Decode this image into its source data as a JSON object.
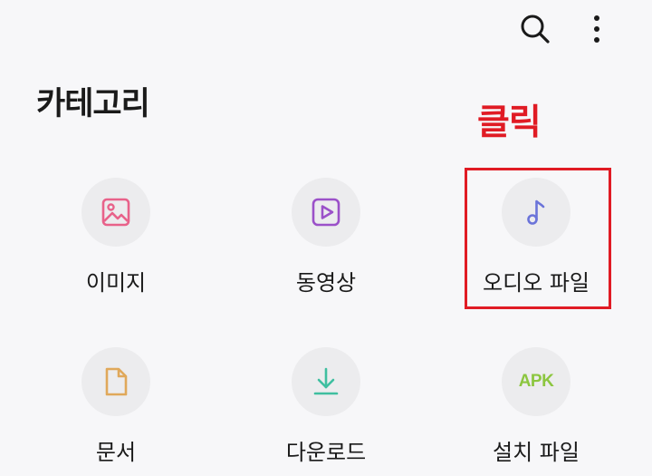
{
  "header": {
    "search_icon": "search-icon",
    "more_icon": "more-vertical-icon"
  },
  "section": {
    "title": "카테고리"
  },
  "annotation": {
    "text": "클릭",
    "color": "#e01b24"
  },
  "categories": [
    {
      "label": "이미지",
      "icon": "image-icon",
      "color": "#e8628a"
    },
    {
      "label": "동영상",
      "icon": "video-icon",
      "color": "#9b51c9"
    },
    {
      "label": "오디오 파일",
      "icon": "music-note-icon",
      "color": "#6b74d9"
    },
    {
      "label": "문서",
      "icon": "document-icon",
      "color": "#e0a85a"
    },
    {
      "label": "다운로드",
      "icon": "download-icon",
      "color": "#3fbfa0"
    },
    {
      "label": "설치 파일",
      "icon": "apk-icon",
      "icon_text": "APK",
      "color": "#8cc63f"
    }
  ]
}
